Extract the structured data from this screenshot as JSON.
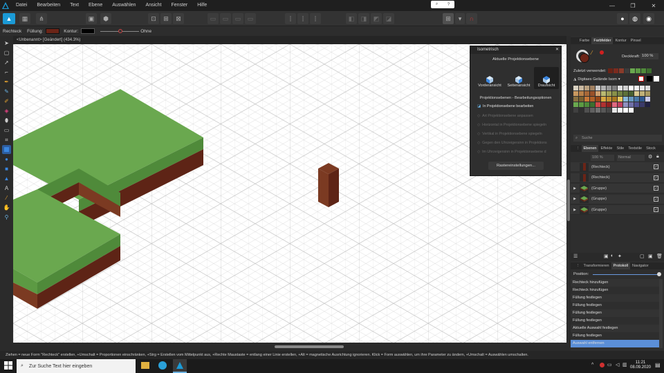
{
  "menubar": {
    "items": [
      "Datei",
      "Bearbeiten",
      "Text",
      "Ebene",
      "Auswählen",
      "Ansicht",
      "Fenster",
      "Hilfe"
    ]
  },
  "context": {
    "tool_name": "Rechteck",
    "fill_label": "Füllung:",
    "fill_color": "#6b2417",
    "stroke_label": "Kontur:",
    "stroke_color": "#000000",
    "stroke_width": "Ohne"
  },
  "document": {
    "tab_title": "<Unbenannt> [Geändert] (434.3%)"
  },
  "isometric": {
    "title": "Isometrisch",
    "section1": "Aktuelle Projektionsebene",
    "views": [
      "Vorderansicht",
      "Seitenansicht",
      "Draufsicht"
    ],
    "section2": "Projektionsebenen - Bearbeitungsoptionen",
    "edit_option": "In Projektionsebene bearbeiten",
    "options": [
      "Art Projektionsebene anpassen",
      "Horizontal in Projektionsebene spiegeln",
      "Vertikal in Projektionsebene spiegeln",
      "Gegen den Uhrzeigersinn in Projektions",
      "Im Uhrzeigersinn in Projektionsebene d"
    ],
    "raster_button": "Rastereinstellungen..."
  },
  "color_panel": {
    "tabs": [
      "Farbe",
      "Farbfelder",
      "Kontur",
      "Pinsel"
    ],
    "active_tab": "Farbfelder",
    "opacity_label": "Deckkraft:",
    "opacity_value": "100 %",
    "recent_label": "Zuletzt verwendet:",
    "palette_name": "Digitaes Gelände Isom",
    "search_placeholder": "Suche",
    "recent_swatches": [
      "#6b2417",
      "#7b2b1f",
      "#8a3b2a",
      "#3c3c3c",
      "#6aa84f",
      "#5c9a43",
      "#4f8a3a",
      "#3d6e2e",
      "#2e2e2e"
    ],
    "swatch_rows": [
      [
        "#d8d0c0",
        "#c8b8a0",
        "#b8a080",
        "#a08060",
        "#c8c8c8",
        "#b0b0b0",
        "#989898",
        "#808080",
        "#e0e0e0",
        "#d0d0d0",
        "#ffffff",
        "#f0f0f0",
        "#e8e8e8",
        "#dcdcdc"
      ],
      [
        "#c89860",
        "#b88048",
        "#a86838",
        "#985028",
        "#d0a070",
        "#b8b870",
        "#a0a058",
        "#889048",
        "#708040",
        "#5c7038",
        "#486030",
        "#d8c890",
        "#c0b078",
        "#a89860"
      ],
      [
        "#8a7040",
        "#7a6030",
        "#c87838",
        "#b06028",
        "#984818",
        "#d8a840",
        "#c09030",
        "#a87820",
        "#e8c860",
        "#88b8d8",
        "#6898c0",
        "#4878a8",
        "#305890",
        "#c8c8e8"
      ],
      [
        "#6aa84f",
        "#5c9a43",
        "#4f8a3a",
        "#3d6e2e",
        "#d04848",
        "#b03030",
        "#902020",
        "#e06880",
        "#c04060",
        "#9090c0",
        "#7070a8",
        "#505090",
        "#3a3a6a",
        "#202040"
      ],
      [
        "#404040",
        "#303030",
        "#505050",
        "#606060",
        "#707070",
        "#585858",
        "#484848",
        "#e8e8e8",
        "#f8f8f8",
        "#ffffff",
        "#fafafa",
        "#2e2e2e",
        "#2e2e2e",
        "#2e2e2e"
      ]
    ]
  },
  "layers_panel": {
    "tabs": [
      "Ebenen",
      "Effekte",
      "Stile",
      "Textstile",
      "Stock"
    ],
    "active_tab": "Ebenen",
    "opacity_value": "100 %",
    "blend_mode": "Normal",
    "layers": [
      "(Rechteck)",
      "(Rechteck)",
      "(Gruppe)",
      "(Gruppe)",
      "(Gruppe)"
    ]
  },
  "history_panel": {
    "tabs": [
      "Transformieren",
      "Protokoll",
      "Navigator"
    ],
    "active_tab": "Protokoll",
    "position_label": "Position:",
    "items": [
      "Rechteck hinzufügen",
      "Rechteck hinzufügen",
      "Füllung festlegen",
      "Füllung festlegen",
      "Füllung festlegen",
      "Füllung festlegen",
      "Aktuelle Auswahl festlegen",
      "Füllung festlegen",
      "Auswahl entfernen"
    ],
    "selected_index": 8
  },
  "statusbar": {
    "text": "Ziehen = neue Form \"Rechteck\" erstellen, +Umschalt = Proportionen einschränken, +Strg = Erstellen vom Mittelpunkt aus, +Rechte Maustaste = entlang einer Linie erstellen, +Alt = magnetische Ausrichtung ignorieren. Klick = Form auswählen, um ihre Parameter zu ändern, +Umschalt = Auswählen umschalten."
  },
  "taskbar": {
    "search_placeholder": "Zur Suche Text hier eingeben",
    "time": "11:21",
    "date": "08.09.2020"
  },
  "colors": {
    "grass_top": "#6aa84f",
    "grass_side_left": "#5c9a43",
    "grass_side_right": "#4f8a3a",
    "dirt_left": "#7b3a22",
    "dirt_right": "#5e2416",
    "accent": "#5b8fd8"
  }
}
